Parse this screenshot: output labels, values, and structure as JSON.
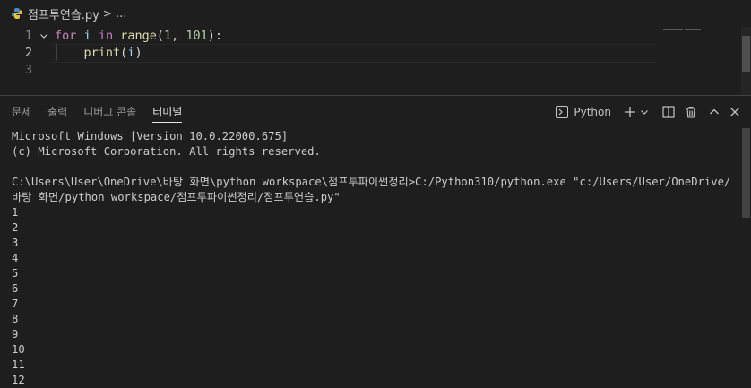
{
  "breadcrumb": {
    "file_name": "점프투연습.py",
    "separator": ">",
    "more": "..."
  },
  "editor": {
    "lines": [
      {
        "number": "1",
        "tokens": [
          [
            "kw",
            "for"
          ],
          [
            "punc",
            " "
          ],
          [
            "id",
            "i"
          ],
          [
            "punc",
            " "
          ],
          [
            "kw",
            "in"
          ],
          [
            "punc",
            " "
          ],
          [
            "fn",
            "range"
          ],
          [
            "punc",
            "("
          ],
          [
            "num",
            "1"
          ],
          [
            "punc",
            ", "
          ],
          [
            "num",
            "101"
          ],
          [
            "punc",
            "):"
          ]
        ]
      },
      {
        "number": "2",
        "tokens": [
          [
            "punc",
            "    "
          ],
          [
            "fn",
            "print"
          ],
          [
            "punc",
            "("
          ],
          [
            "id",
            "i"
          ],
          [
            "punc",
            ")"
          ]
        ]
      },
      {
        "number": "3",
        "tokens": []
      }
    ],
    "active_line": 2
  },
  "panel": {
    "tabs": [
      "문제",
      "출력",
      "디버그 콘솔",
      "터미널"
    ],
    "active_tab": "터미널",
    "terminal_profile": "Python",
    "terminal_lines": [
      "Microsoft Windows [Version 10.0.22000.675]",
      "(c) Microsoft Corporation. All rights reserved.",
      "",
      "C:\\Users\\User\\OneDrive\\바탕 화면\\python workspace\\점프투파이썬정리>C:/Python310/python.exe \"c:/Users/User/OneDrive/",
      "바탕 화면/python workspace/점프투파이썬정리/점프투연습.py\"",
      "1",
      "2",
      "3",
      "4",
      "5",
      "6",
      "7",
      "8",
      "9",
      "10",
      "11",
      "12"
    ]
  },
  "colors": {
    "background": "#1e1e1e",
    "keyword": "#c586c0",
    "function": "#dcdcaa",
    "number": "#b5cea8",
    "variable": "#9cdcfe"
  }
}
